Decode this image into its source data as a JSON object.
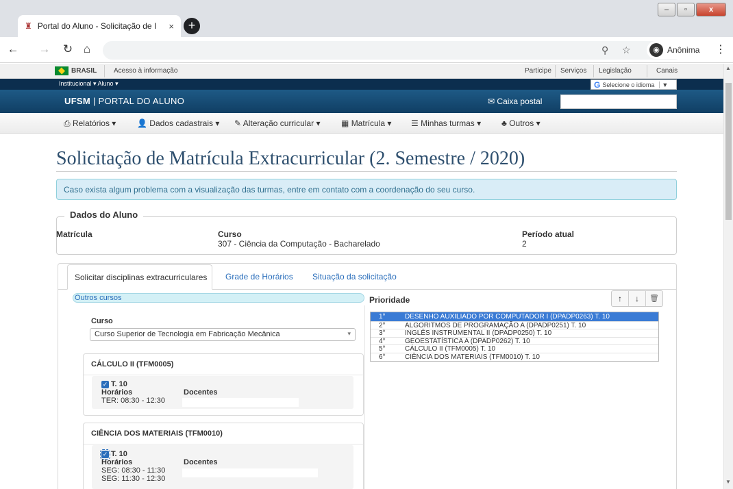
{
  "browser": {
    "tab_title": "Portal do Aluno - Solicitação de I",
    "tab_close": "×",
    "new_tab": "+",
    "ghost_tabs": " ",
    "profile_label": "Anônima",
    "url": ""
  },
  "gov": {
    "brasil": "BRASIL",
    "acesso": "Acesso à informação",
    "links": [
      "Participe",
      "Serviços",
      "Legislação",
      "Canais"
    ]
  },
  "inst": {
    "left": "Institucional ▾   Aluno ▾",
    "lang": "Selecione o idioma",
    "lang_caret": "▼"
  },
  "portal": {
    "title_bold": "UFSM",
    "title_rest": " | PORTAL DO ALUNO",
    "caixa": "Caixa postal"
  },
  "menu": [
    {
      "icon": "⎙",
      "label": "Relatórios ▾"
    },
    {
      "icon": "👤",
      "label": "Dados cadastrais ▾"
    },
    {
      "icon": "✎",
      "label": "Alteração curricular ▾"
    },
    {
      "icon": "▦",
      "label": "Matrícula ▾"
    },
    {
      "icon": "☰",
      "label": "Minhas turmas ▾"
    },
    {
      "icon": "♣",
      "label": "Outros ▾"
    }
  ],
  "page": {
    "title": "Solicitação de Matrícula Extracurricular (2. Semestre / 2020)",
    "alert": "Caso exista algum problema com a visualização das turmas, entre em contato com a coordenação do seu curso."
  },
  "aluno": {
    "legend": "Dados do Aluno",
    "matricula_label": "Matrícula",
    "curso_label": "Curso",
    "curso_value": "307 - Ciência da Computação - Bacharelado",
    "periodo_label": "Período atual",
    "periodo_value": "2"
  },
  "tabs": [
    "Solicitar disciplinas extracurriculares",
    "Grade de Horários",
    "Situação da solicitação"
  ],
  "left": {
    "outros": "Outros cursos",
    "curso_label": "Curso",
    "curso_select": "Curso Superior de Tecnologia em Fabricação Mecânica",
    "cards": [
      {
        "title": "CÁLCULO II (TFM0005)",
        "turma": "T. 10",
        "horarios_label": "Horários",
        "docentes_label": "Docentes",
        "horarios": [
          "TER: 08:30 - 12:30"
        ]
      },
      {
        "title": "CIÊNCIA DOS MATERIAIS (TFM0010)",
        "turma": "T. 10",
        "horarios_label": "Horários",
        "docentes_label": "Docentes",
        "horarios": [
          "SEG: 08:30 - 11:30",
          "SEG: 11:30 - 12:30"
        ]
      }
    ]
  },
  "prioridade": {
    "title": "Prioridade",
    "up": "↑",
    "down": "↓",
    "delete": "🗑",
    "items": [
      {
        "n": "1°",
        "t": "DESENHO AUXILIADO POR COMPUTADOR I (DPADP0263) T. 10"
      },
      {
        "n": "2°",
        "t": "ALGORITMOS DE PROGRAMAÇÃO A (DPADP0251) T. 10"
      },
      {
        "n": "3°",
        "t": "INGLÊS INSTRUMENTAL II (DPADP0250) T. 10"
      },
      {
        "n": "4°",
        "t": "GEOESTATÍSTICA A (DPADP0262) T. 10"
      },
      {
        "n": "5°",
        "t": "CÁLCULO II (TFM0005) T. 10"
      },
      {
        "n": "6°",
        "t": "CIÊNCIA DOS MATERIAIS (TFM0010) T. 10"
      }
    ]
  }
}
